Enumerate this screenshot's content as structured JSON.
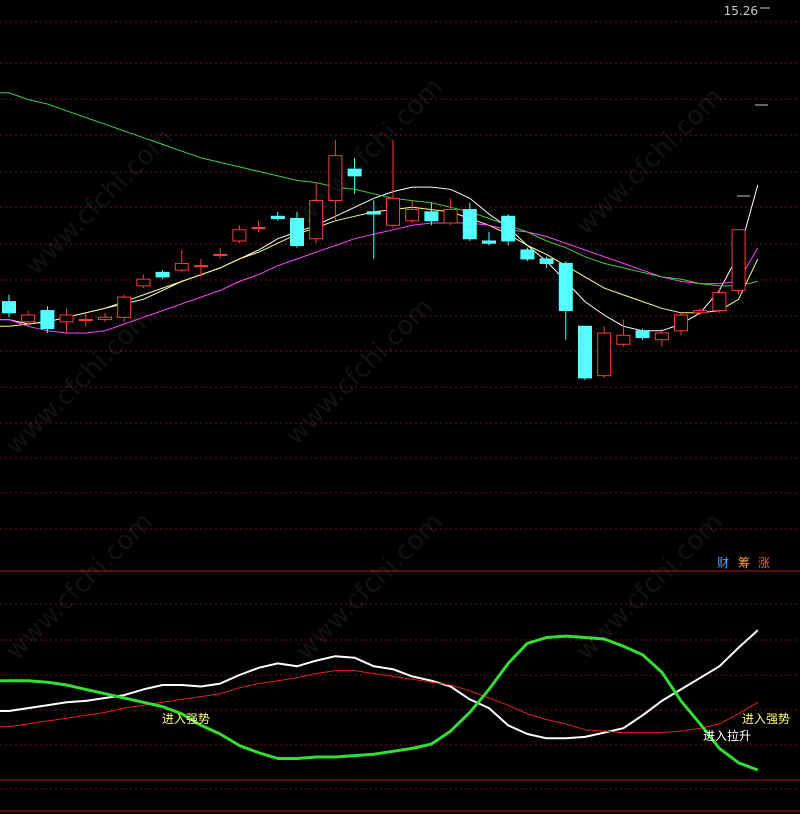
{
  "price_marker": "15.26",
  "buttons": {
    "cai": "财",
    "chou": "筹",
    "zhang": "涨"
  },
  "watermark": "www.cfchi.com",
  "colors": {
    "background": "#000000",
    "grid": "#7a1010",
    "divider": "#b01818",
    "up_candle": "#ff3b3b",
    "down_candle": "#54ffff",
    "ma_short": "#ffffff",
    "ma_mid": "#ffff80",
    "ma_long1": "#ff40ff",
    "ma_long2": "#40cc40",
    "ind_white": "#ffffff",
    "ind_red": "#dd2222",
    "ind_green": "#33dd33"
  },
  "chart_data": [
    {
      "type": "candlestick",
      "panel": "main",
      "ylim": [
        13.3,
        15.26
      ],
      "candles": [
        {
          "o": 13.97,
          "c": 13.92,
          "h": 14.0,
          "l": 13.9
        },
        {
          "o": 13.88,
          "c": 13.91,
          "h": 13.93,
          "l": 13.86
        },
        {
          "o": 13.93,
          "c": 13.85,
          "h": 13.95,
          "l": 13.83
        },
        {
          "o": 13.88,
          "c": 13.91,
          "h": 13.94,
          "l": 13.83
        },
        {
          "o": 13.89,
          "c": 13.89,
          "h": 13.92,
          "l": 13.86
        },
        {
          "o": 13.89,
          "c": 13.9,
          "h": 13.92,
          "l": 13.88
        },
        {
          "o": 13.9,
          "c": 13.99,
          "h": 14.0,
          "l": 13.88
        },
        {
          "o": 14.04,
          "c": 14.07,
          "h": 14.09,
          "l": 14.03
        },
        {
          "o": 14.1,
          "c": 14.08,
          "h": 14.11,
          "l": 14.07
        },
        {
          "o": 14.11,
          "c": 14.14,
          "h": 14.2,
          "l": 14.1
        },
        {
          "o": 14.13,
          "c": 14.13,
          "h": 14.16,
          "l": 14.08
        },
        {
          "o": 14.18,
          "c": 14.18,
          "h": 14.21,
          "l": 14.16
        },
        {
          "o": 14.24,
          "c": 14.29,
          "h": 14.31,
          "l": 14.23
        },
        {
          "o": 14.3,
          "c": 14.3,
          "h": 14.33,
          "l": 14.28
        },
        {
          "o": 14.35,
          "c": 14.34,
          "h": 14.37,
          "l": 14.33
        },
        {
          "o": 14.34,
          "c": 14.22,
          "h": 14.37,
          "l": 14.21
        },
        {
          "o": 14.25,
          "c": 14.42,
          "h": 14.5,
          "l": 14.23
        },
        {
          "o": 14.42,
          "c": 14.62,
          "h": 14.69,
          "l": 14.33
        },
        {
          "o": 14.56,
          "c": 14.53,
          "h": 14.61,
          "l": 14.45
        },
        {
          "o": 14.37,
          "c": 14.36,
          "h": 14.42,
          "l": 14.16
        },
        {
          "o": 14.31,
          "c": 14.43,
          "h": 14.69,
          "l": 14.3
        },
        {
          "o": 14.33,
          "c": 14.38,
          "h": 14.42,
          "l": 14.32
        },
        {
          "o": 14.37,
          "c": 14.33,
          "h": 14.41,
          "l": 14.31
        },
        {
          "o": 14.32,
          "c": 14.38,
          "h": 14.43,
          "l": 14.31
        },
        {
          "o": 14.38,
          "c": 14.25,
          "h": 14.41,
          "l": 14.24
        },
        {
          "o": 14.24,
          "c": 14.23,
          "h": 14.28,
          "l": 14.22
        },
        {
          "o": 14.35,
          "c": 14.24,
          "h": 14.36,
          "l": 14.22
        },
        {
          "o": 14.2,
          "c": 14.16,
          "h": 14.21,
          "l": 14.15
        },
        {
          "o": 14.16,
          "c": 14.14,
          "h": 14.17,
          "l": 14.12
        },
        {
          "o": 14.14,
          "c": 13.93,
          "h": 14.15,
          "l": 13.8
        },
        {
          "o": 13.86,
          "c": 13.63,
          "h": 13.86,
          "l": 13.62
        },
        {
          "o": 13.64,
          "c": 13.83,
          "h": 13.86,
          "l": 13.63
        },
        {
          "o": 13.78,
          "c": 13.82,
          "h": 13.89,
          "l": 13.77
        },
        {
          "o": 13.84,
          "c": 13.81,
          "h": 13.85,
          "l": 13.8
        },
        {
          "o": 13.8,
          "c": 13.83,
          "h": 13.85,
          "l": 13.77
        },
        {
          "o": 13.84,
          "c": 13.91,
          "h": 13.92,
          "l": 13.82
        },
        {
          "o": 13.92,
          "c": 13.93,
          "h": 13.94,
          "l": 13.91
        },
        {
          "o": 13.93,
          "c": 14.01,
          "h": 14.03,
          "l": 13.92
        },
        {
          "o": 14.02,
          "c": 14.29,
          "h": 14.29,
          "l": 14.0
        }
      ],
      "ma": [
        {
          "name": "MA-white",
          "color": "#ffffff",
          "values": [
            13.89,
            13.87,
            13.88,
            13.9,
            13.92,
            13.94,
            13.96,
            13.98,
            14.02,
            14.06,
            14.09,
            14.12,
            14.16,
            14.2,
            14.25,
            14.28,
            14.31,
            14.35,
            14.39,
            14.43,
            14.46,
            14.48,
            14.48,
            14.47,
            14.43,
            14.36,
            14.3,
            14.22,
            14.15,
            14.06,
            13.97,
            13.91,
            13.86,
            13.84,
            13.84,
            13.87,
            13.92,
            14.02,
            14.18,
            14.49
          ]
        },
        {
          "name": "MA-yellow",
          "color": "#ffff80",
          "values": [
            13.86,
            13.87,
            13.88,
            13.9,
            13.92,
            13.94,
            13.97,
            14.0,
            14.03,
            14.06,
            14.09,
            14.12,
            14.16,
            14.19,
            14.23,
            14.27,
            14.3,
            14.33,
            14.35,
            14.37,
            14.38,
            14.39,
            14.38,
            14.37,
            14.34,
            14.31,
            14.27,
            14.22,
            14.18,
            14.13,
            14.08,
            14.03,
            14.0,
            13.97,
            13.94,
            13.92,
            13.92,
            13.93,
            13.98,
            14.16
          ]
        },
        {
          "name": "MA-magenta",
          "color": "#ff40ff",
          "values": [
            13.89,
            13.86,
            13.84,
            13.83,
            13.83,
            13.84,
            13.87,
            13.9,
            13.93,
            13.96,
            13.99,
            14.02,
            14.06,
            14.09,
            14.13,
            14.16,
            14.19,
            14.22,
            14.25,
            14.27,
            14.29,
            14.31,
            14.32,
            14.32,
            14.32,
            14.31,
            14.29,
            14.28,
            14.26,
            14.23,
            14.2,
            14.17,
            14.14,
            14.11,
            14.08,
            14.06,
            14.05,
            14.05,
            14.06,
            14.21
          ]
        },
        {
          "name": "MA-green",
          "color": "#40cc40",
          "values": [
            14.9,
            14.87,
            14.85,
            14.82,
            14.79,
            14.76,
            14.73,
            14.7,
            14.67,
            14.64,
            14.61,
            14.59,
            14.57,
            14.55,
            14.53,
            14.51,
            14.5,
            14.48,
            14.47,
            14.45,
            14.43,
            14.42,
            14.41,
            14.39,
            14.37,
            14.34,
            14.31,
            14.28,
            14.24,
            14.21,
            14.17,
            14.14,
            14.12,
            14.1,
            14.08,
            14.07,
            14.05,
            14.04,
            14.04,
            14.06
          ]
        }
      ]
    },
    {
      "type": "line",
      "panel": "indicator",
      "ylim": [
        0,
        100
      ],
      "series": [
        {
          "name": "white",
          "color": "#ffffff",
          "values": [
            41,
            43,
            45,
            47,
            48,
            50,
            52,
            56,
            59,
            59,
            58,
            60,
            66,
            71,
            74,
            72,
            76,
            79,
            78,
            72,
            70,
            65,
            62,
            58,
            49,
            43,
            31,
            25,
            22,
            22,
            23,
            26,
            29,
            38,
            48,
            56,
            64,
            72,
            85,
            97
          ]
        },
        {
          "name": "red",
          "color": "#dd2222",
          "values": [
            30,
            32,
            34,
            36,
            38,
            40,
            43,
            45,
            47,
            49,
            51,
            53,
            57,
            60,
            62,
            64,
            67,
            69,
            69,
            67,
            65,
            63,
            61,
            59,
            55,
            50,
            45,
            39,
            35,
            32,
            28,
            27,
            26,
            26,
            26,
            27,
            29,
            32,
            39,
            47
          ]
        },
        {
          "name": "green",
          "color": "#33dd33",
          "values": [
            62,
            62,
            61,
            59,
            56,
            53,
            50,
            47,
            44,
            39,
            31,
            25,
            17,
            12,
            8,
            8,
            9,
            9,
            10,
            11,
            13,
            15,
            18,
            27,
            40,
            56,
            74,
            88,
            92,
            93,
            92,
            91,
            86,
            80,
            68,
            48,
            32,
            15,
            5,
            0
          ]
        }
      ],
      "annotations": [
        "进入强势",
        "进入强势",
        "进入拉升"
      ]
    }
  ]
}
